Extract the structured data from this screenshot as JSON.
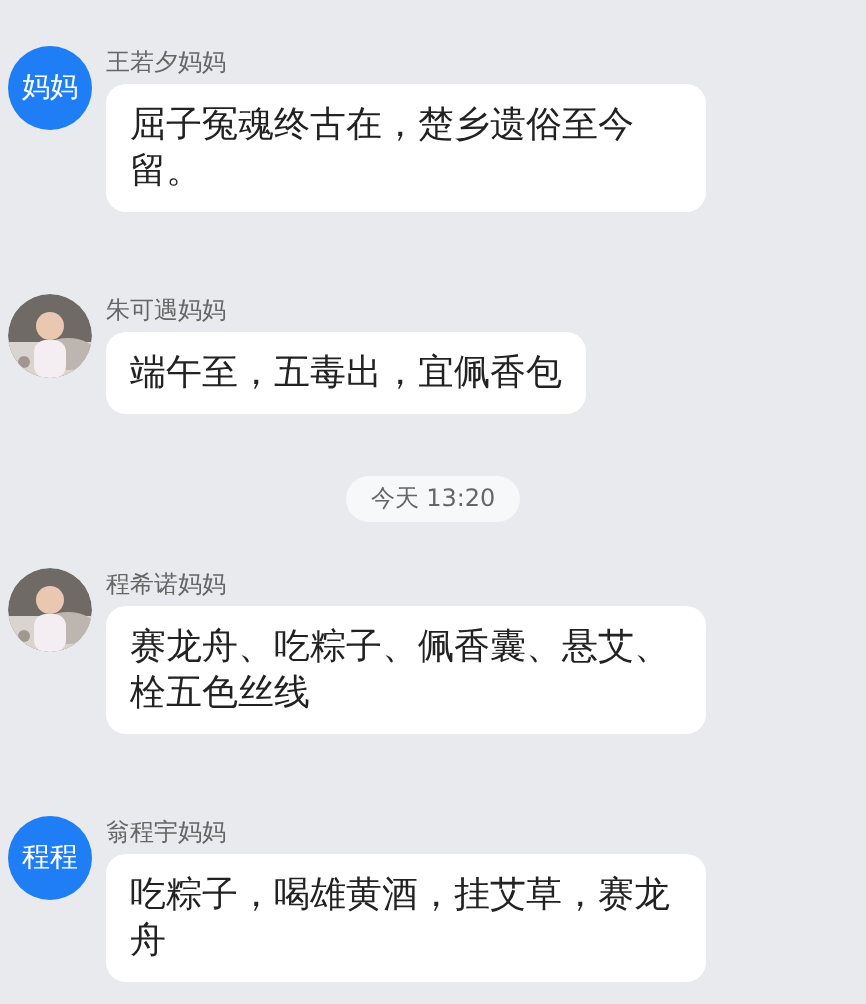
{
  "messages": [
    {
      "sender": "王若夕妈妈",
      "avatar": {
        "kind": "initials",
        "text": "妈妈",
        "color": "#1f7df6"
      },
      "text": "屈子冤魂终古在，楚乡遗俗至今留。"
    },
    {
      "sender": "朱可遇妈妈",
      "text": "端午至，五毒出，宜佩香包"
    },
    {
      "kind": "time",
      "text": "今天 13:20"
    },
    {
      "sender": "程希诺妈妈",
      "text": "赛龙舟、吃粽子、佩香囊、悬艾、栓五色丝线"
    },
    {
      "sender": "翁程宇妈妈",
      "avatar": {
        "kind": "initials",
        "text": "程程",
        "color": "#1f7df6"
      },
      "text": "吃粽子，喝雄黄酒，挂艾草，赛龙舟"
    }
  ]
}
